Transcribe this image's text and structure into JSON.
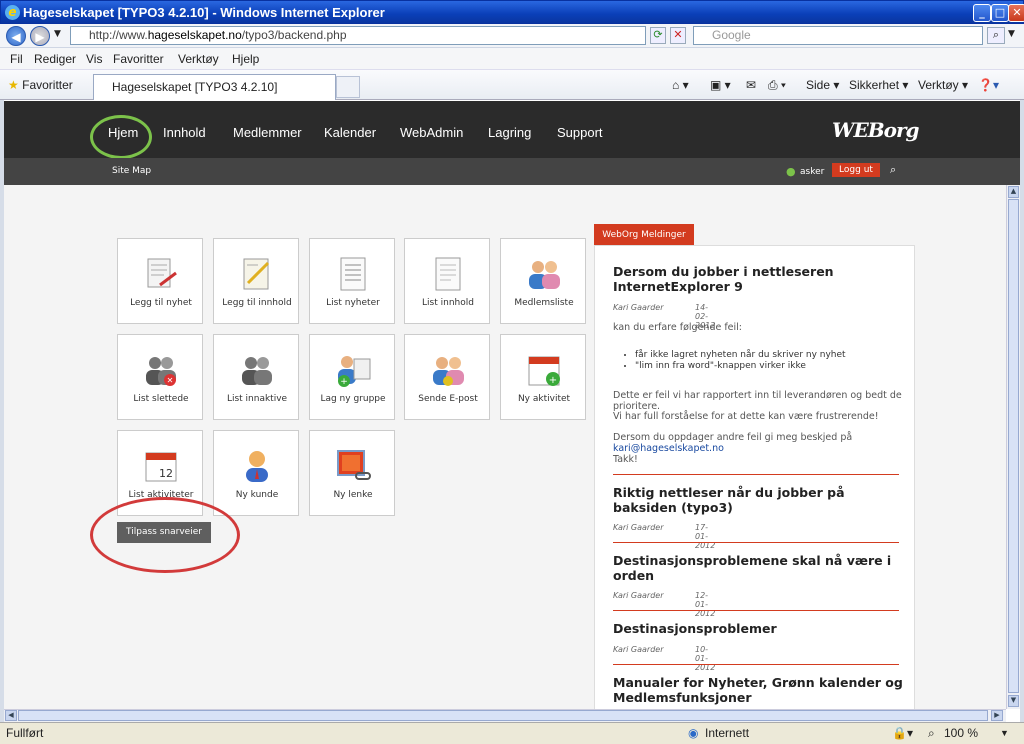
{
  "window": {
    "title": "Hageselskapet [TYPO3 4.2.10] - Windows Internet Explorer"
  },
  "address": {
    "prefix": "http://www.",
    "domain": "hageselskapet.no",
    "path": "/typo3/backend.php"
  },
  "search": {
    "placeholder": "Google"
  },
  "menu": [
    "Fil",
    "Rediger",
    "Vis",
    "Favoritter",
    "Verktøy",
    "Hjelp"
  ],
  "favorites_label": "Favoritter",
  "tab": {
    "label": "Hageselskapet [TYPO3 4.2.10]"
  },
  "tools": {
    "side": "Side",
    "sikkerhet": "Sikkerhet",
    "verktoy": "Verktøy"
  },
  "nav": [
    "Hjem",
    "Innhold",
    "Medlemmer",
    "Kalender",
    "WebAdmin",
    "Lagring",
    "Support"
  ],
  "logo": "WEBorg",
  "subnav": {
    "sitemap": "Site Map",
    "user": "asker",
    "logout": "Logg ut"
  },
  "tiles": [
    "Legg til nyhet",
    "Legg til innhold",
    "List nyheter",
    "List innhold",
    "Medlemsliste",
    "List slettede",
    "List innaktive",
    "Lag ny gruppe",
    "Sende E-post",
    "Ny aktivitet",
    "List aktiviteter",
    "Ny kunde",
    "Ny lenke"
  ],
  "customize_button": "Tilpass snarveier",
  "messages": {
    "tab": "WebOrg Meldinger",
    "items": [
      {
        "title": "Dersom du jobber i nettleseren InternetExplorer 9",
        "author": "Kari Gaarder",
        "date": "14-02-2012",
        "intro": "kan du erfare følgende feil:",
        "bullets": [
          "får ikke lagret nyheten når du skriver ny nyhet",
          "\"lim inn fra word\"-knappen virker ikke"
        ],
        "body1": "Dette er feil vi har rapportert inn til leverandøren og bedt de prioritere.",
        "body2": "Vi har full forståelse for at dette kan være frustrerende!",
        "body3": "Dersom du oppdager andre feil gi meg beskjed på",
        "email": "kari@hageselskapet.no",
        "thanks": "Takk!"
      },
      {
        "title": "Riktig nettleser når du jobber på baksiden (typo3)",
        "author": "Kari Gaarder",
        "date": "17-01-2012"
      },
      {
        "title": "Destinasjonsproblemene skal nå være i orden",
        "author": "Kari Gaarder",
        "date": "12-01-2012"
      },
      {
        "title": "Destinasjonsproblemer",
        "author": "Kari Gaarder",
        "date": "10-01-2012"
      },
      {
        "title": "Manualer for Nyheter, Grønn kalender og Medlemsfunksjoner"
      }
    ]
  },
  "status": {
    "text": "Fullført",
    "zone": "Internett",
    "zoom": "100 %"
  },
  "colors": {
    "accent": "#d33b1f",
    "header": "#2b2b2b",
    "highlight_green": "#7cc24a",
    "highlight_red": "#d23a3a"
  }
}
